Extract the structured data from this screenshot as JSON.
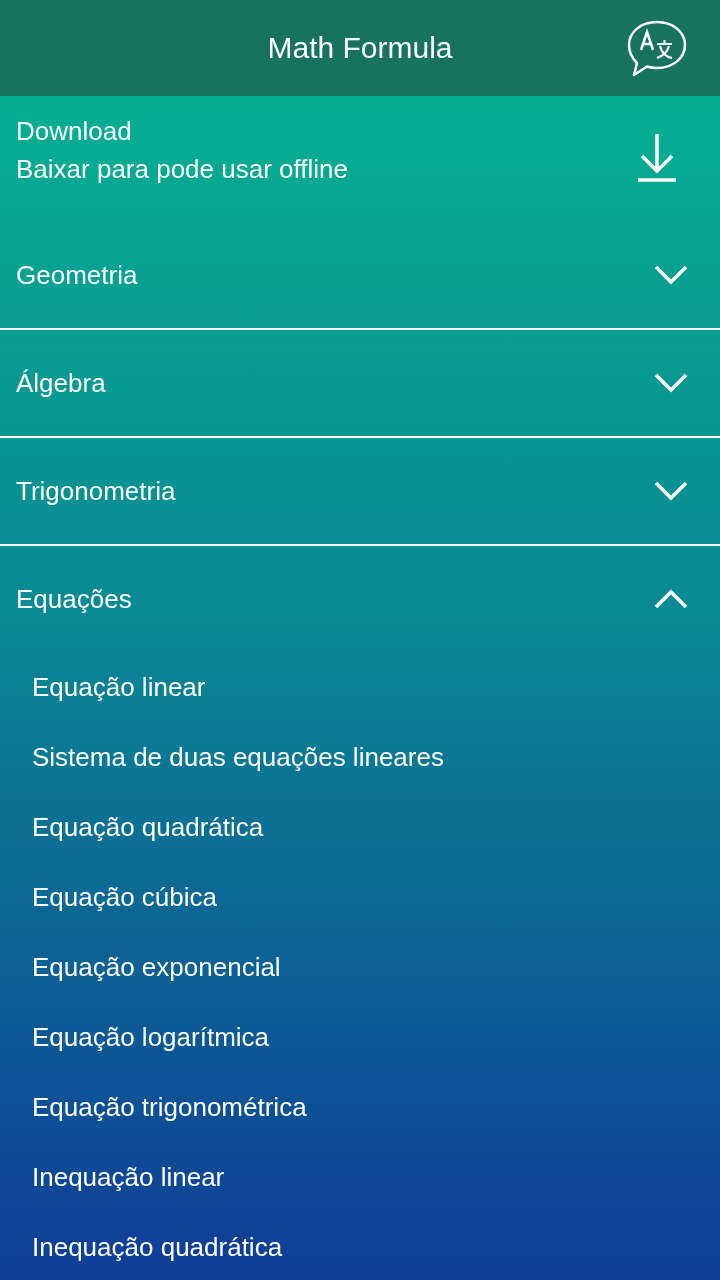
{
  "app_bar": {
    "title": "Math Formula"
  },
  "download": {
    "title": "Download",
    "subtitle": "Baixar para pode usar offline"
  },
  "categories": [
    {
      "label": "Geometria",
      "expanded": false
    },
    {
      "label": "Álgebra",
      "expanded": false
    },
    {
      "label": "Trigonometria",
      "expanded": false
    },
    {
      "label": "Equações",
      "expanded": true,
      "items": [
        {
          "label": "Equação linear"
        },
        {
          "label": "Sistema de duas equações lineares"
        },
        {
          "label": "Equação quadrática"
        },
        {
          "label": "Equação cúbica"
        },
        {
          "label": "Equação exponencial"
        },
        {
          "label": "Equação logarítmica"
        },
        {
          "label": "Equação trigonométrica"
        },
        {
          "label": "Inequação linear"
        },
        {
          "label": "Inequação quadrática"
        }
      ]
    }
  ]
}
